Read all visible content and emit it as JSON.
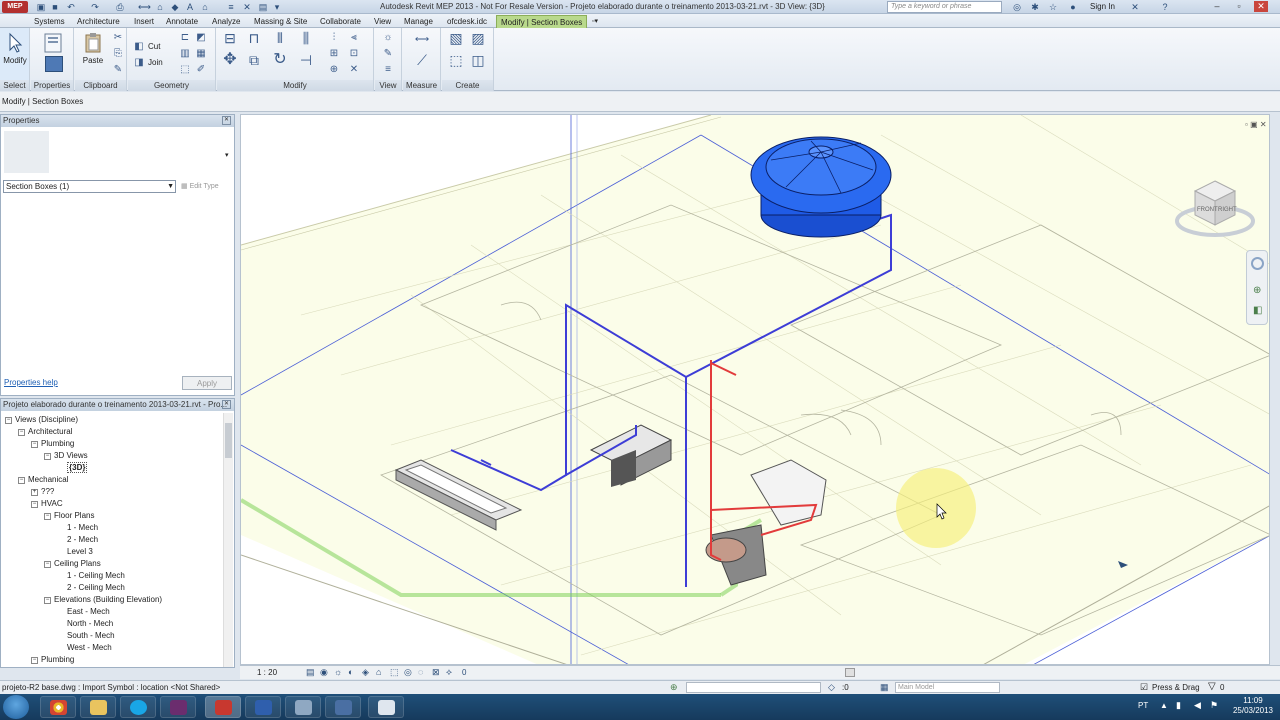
{
  "app": {
    "logo": "MEP",
    "title": "Autodesk Revit MEP 2013 - Not For Resale Version -    Projeto elaborado durante o treinamento 2013-03-21.rvt - 3D View: {3D}",
    "search_placeholder": "Type a keyword or phrase",
    "sign_in": "Sign In"
  },
  "ribbon": {
    "tabs": [
      {
        "label": "Systems"
      },
      {
        "label": "Architecture"
      },
      {
        "label": "Insert"
      },
      {
        "label": "Annotate"
      },
      {
        "label": "Analyze"
      },
      {
        "label": "Massing & Site"
      },
      {
        "label": "Collaborate"
      },
      {
        "label": "View"
      },
      {
        "label": "Manage"
      },
      {
        "label": "ofcdesk.idc"
      },
      {
        "label": "Modify | Section Boxes"
      }
    ],
    "tools": {
      "modify": "Modify",
      "paste": "Paste",
      "cut": "Cut",
      "join": "Join"
    },
    "panels": [
      "Select",
      "Properties",
      "Clipboard",
      "Geometry",
      "Modify",
      "View",
      "Measure",
      "Create"
    ]
  },
  "options_bar": {
    "context": "Modify | Section Boxes"
  },
  "properties": {
    "title": "Properties",
    "type_selector": "Section Boxes (1)",
    "edit_type": "Edit Type",
    "help": "Properties help",
    "apply": "Apply"
  },
  "browser": {
    "title": "Projeto elaborado durante o treinamento 2013-03-21.rvt - Pro...",
    "items": [
      {
        "label": "Views (Discipline)",
        "indent": 0,
        "toggle": "−"
      },
      {
        "label": "Architectural",
        "indent": 1,
        "toggle": "−"
      },
      {
        "label": "Plumbing",
        "indent": 2,
        "toggle": "−"
      },
      {
        "label": "3D Views",
        "indent": 3,
        "toggle": "−"
      },
      {
        "label": "{3D}",
        "indent": 4,
        "toggle": "",
        "selected": true
      },
      {
        "label": "Mechanical",
        "indent": 1,
        "toggle": "−"
      },
      {
        "label": "???",
        "indent": 2,
        "toggle": "+"
      },
      {
        "label": "HVAC",
        "indent": 2,
        "toggle": "−"
      },
      {
        "label": "Floor Plans",
        "indent": 3,
        "toggle": "−"
      },
      {
        "label": "1 - Mech",
        "indent": 4,
        "toggle": ""
      },
      {
        "label": "2 - Mech",
        "indent": 4,
        "toggle": ""
      },
      {
        "label": "Level 3",
        "indent": 4,
        "toggle": ""
      },
      {
        "label": "Ceiling Plans",
        "indent": 3,
        "toggle": "−"
      },
      {
        "label": "1 - Ceiling Mech",
        "indent": 4,
        "toggle": ""
      },
      {
        "label": "2 - Ceiling Mech",
        "indent": 4,
        "toggle": ""
      },
      {
        "label": "Elevations (Building Elevation)",
        "indent": 3,
        "toggle": "−"
      },
      {
        "label": "East - Mech",
        "indent": 4,
        "toggle": ""
      },
      {
        "label": "North - Mech",
        "indent": 4,
        "toggle": ""
      },
      {
        "label": "South - Mech",
        "indent": 4,
        "toggle": ""
      },
      {
        "label": "West - Mech",
        "indent": 4,
        "toggle": ""
      },
      {
        "label": "Plumbing",
        "indent": 2,
        "toggle": "−"
      }
    ]
  },
  "viewcube": {
    "front": "FRONT",
    "right": "RIGHT"
  },
  "viewbar": {
    "scale": "1 : 20",
    "zero": "0"
  },
  "status": {
    "text": "projeto-R2 base.dwg : Import Symbol : location <Not Shared>",
    "zero": ":0",
    "model": "Main Model",
    "press_drag": "Press & Drag",
    "filter": "0"
  },
  "tray": {
    "lang": "PT",
    "time": "11:09",
    "date": "25/03/2013"
  },
  "colors": {
    "accent_tab": "#b9d98c",
    "pipe_blue": "#3d3dd6",
    "pipe_red": "#e23b3b",
    "pipe_green": "#7fd25a",
    "tank_blue": "#1f5be6",
    "floor": "#fbfde9",
    "highlight": "#f6ef7a"
  }
}
